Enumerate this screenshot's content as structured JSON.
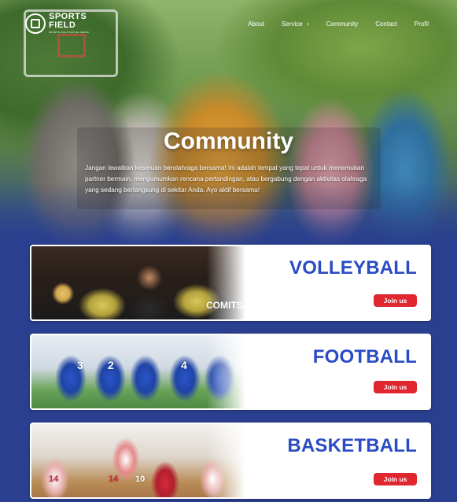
{
  "brand": {
    "line1": "SPORTS",
    "line2": "FIELD",
    "tagline": "SPORTS FIELD SOCIAL MEDIA"
  },
  "nav": {
    "items": [
      {
        "label": "About"
      },
      {
        "label": "Service",
        "has_submenu": true
      },
      {
        "label": "Community"
      },
      {
        "label": "Contact"
      },
      {
        "label": "Profil"
      }
    ],
    "chevron": "›"
  },
  "hero": {
    "title": "Community",
    "description": "Jangan lewatkan keseruan berolahraga bersama! Ini adalah tempat yang tepat untuk menemukan partner bermain, mengumumkan rencana pertandingan, atau bergabung dengan aktivitas olahraga yang sedang berlangsung di sekitar Anda. Ayo aktif bersama!"
  },
  "sports": [
    {
      "name": "VOLLEYBALL",
      "button": "Join us",
      "photo_text": "COMITSA"
    },
    {
      "name": "FOOTBALL",
      "button": "Join us",
      "jersey_numbers": [
        "3",
        "2",
        "4"
      ]
    },
    {
      "name": "BASKETBALL",
      "button": "Join us",
      "jersey_numbers": [
        "14",
        "10",
        "14"
      ]
    }
  ],
  "colors": {
    "page_bg": "#2a3f8f",
    "title_blue": "#2a4bc4",
    "button_red": "#e0262f"
  }
}
